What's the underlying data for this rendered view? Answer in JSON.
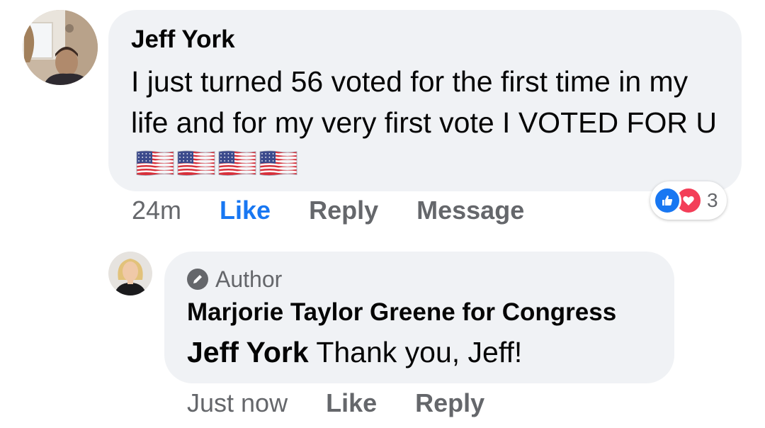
{
  "comment": {
    "author": "Jeff York",
    "text": "I just turned 56 voted for the first time in my life and for my very first vote I VOTED FOR U",
    "flag_count": 4,
    "flag_icon": "us-flag-emoji",
    "timestamp": "24m",
    "like_label": "Like",
    "reply_label": "Reply",
    "message_label": "Message",
    "reactions": {
      "icons": [
        "like-icon",
        "love-icon"
      ],
      "count": "3"
    }
  },
  "reply": {
    "badge_icon": "pencil-icon",
    "badge_label": "Author",
    "author": "Marjorie Taylor Greene for Congress",
    "mention": "Jeff York",
    "text": " Thank you, Jeff!",
    "timestamp": "Just now",
    "like_label": "Like",
    "reply_label": "Reply"
  },
  "colors": {
    "bubble": "#f0f2f5",
    "meta_text": "#65676b",
    "like_active": "#1877f2",
    "love": "#f33e58"
  }
}
